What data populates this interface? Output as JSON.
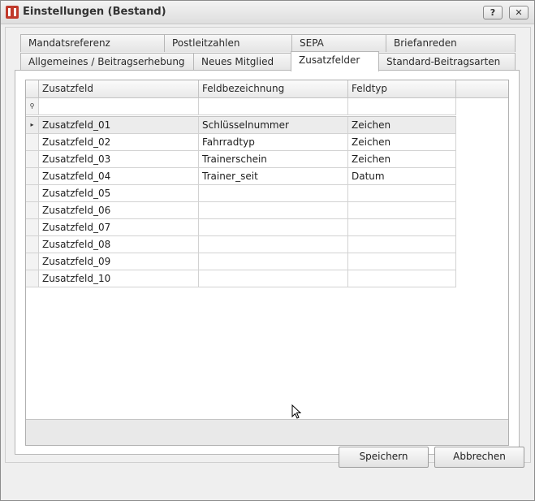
{
  "window": {
    "title": "Einstellungen (Bestand)",
    "help_label": "?",
    "close_label": "✕"
  },
  "tabs": {
    "row1": [
      {
        "label": "Mandatsreferenz"
      },
      {
        "label": "Postleitzahlen"
      },
      {
        "label": "SEPA"
      },
      {
        "label": "Briefanreden"
      }
    ],
    "row2": [
      {
        "label": "Allgemeines / Beitragserhebung"
      },
      {
        "label": "Neues Mitglied"
      },
      {
        "label": "Zusatzfelder",
        "active": true
      },
      {
        "label": "Standard-Beitragsarten"
      }
    ]
  },
  "grid": {
    "columns": [
      "Zusatzfeld",
      "Feldbezeichnung",
      "Feldtyp"
    ],
    "filter_icon": "pin-icon",
    "rows": [
      [
        "Zusatzfeld_01",
        "Schlüsselnummer",
        "Zeichen"
      ],
      [
        "Zusatzfeld_02",
        "Fahrradtyp",
        "Zeichen"
      ],
      [
        "Zusatzfeld_03",
        "Trainerschein",
        "Zeichen"
      ],
      [
        "Zusatzfeld_04",
        "Trainer_seit",
        "Datum"
      ],
      [
        "Zusatzfeld_05",
        "",
        ""
      ],
      [
        "Zusatzfeld_06",
        "",
        ""
      ],
      [
        "Zusatzfeld_07",
        "",
        ""
      ],
      [
        "Zusatzfeld_08",
        "",
        ""
      ],
      [
        "Zusatzfeld_09",
        "",
        ""
      ],
      [
        "Zusatzfeld_10",
        "",
        ""
      ]
    ],
    "focused_row_indicator": "▸"
  },
  "buttons": {
    "save": "Speichern",
    "cancel": "Abbrechen"
  }
}
